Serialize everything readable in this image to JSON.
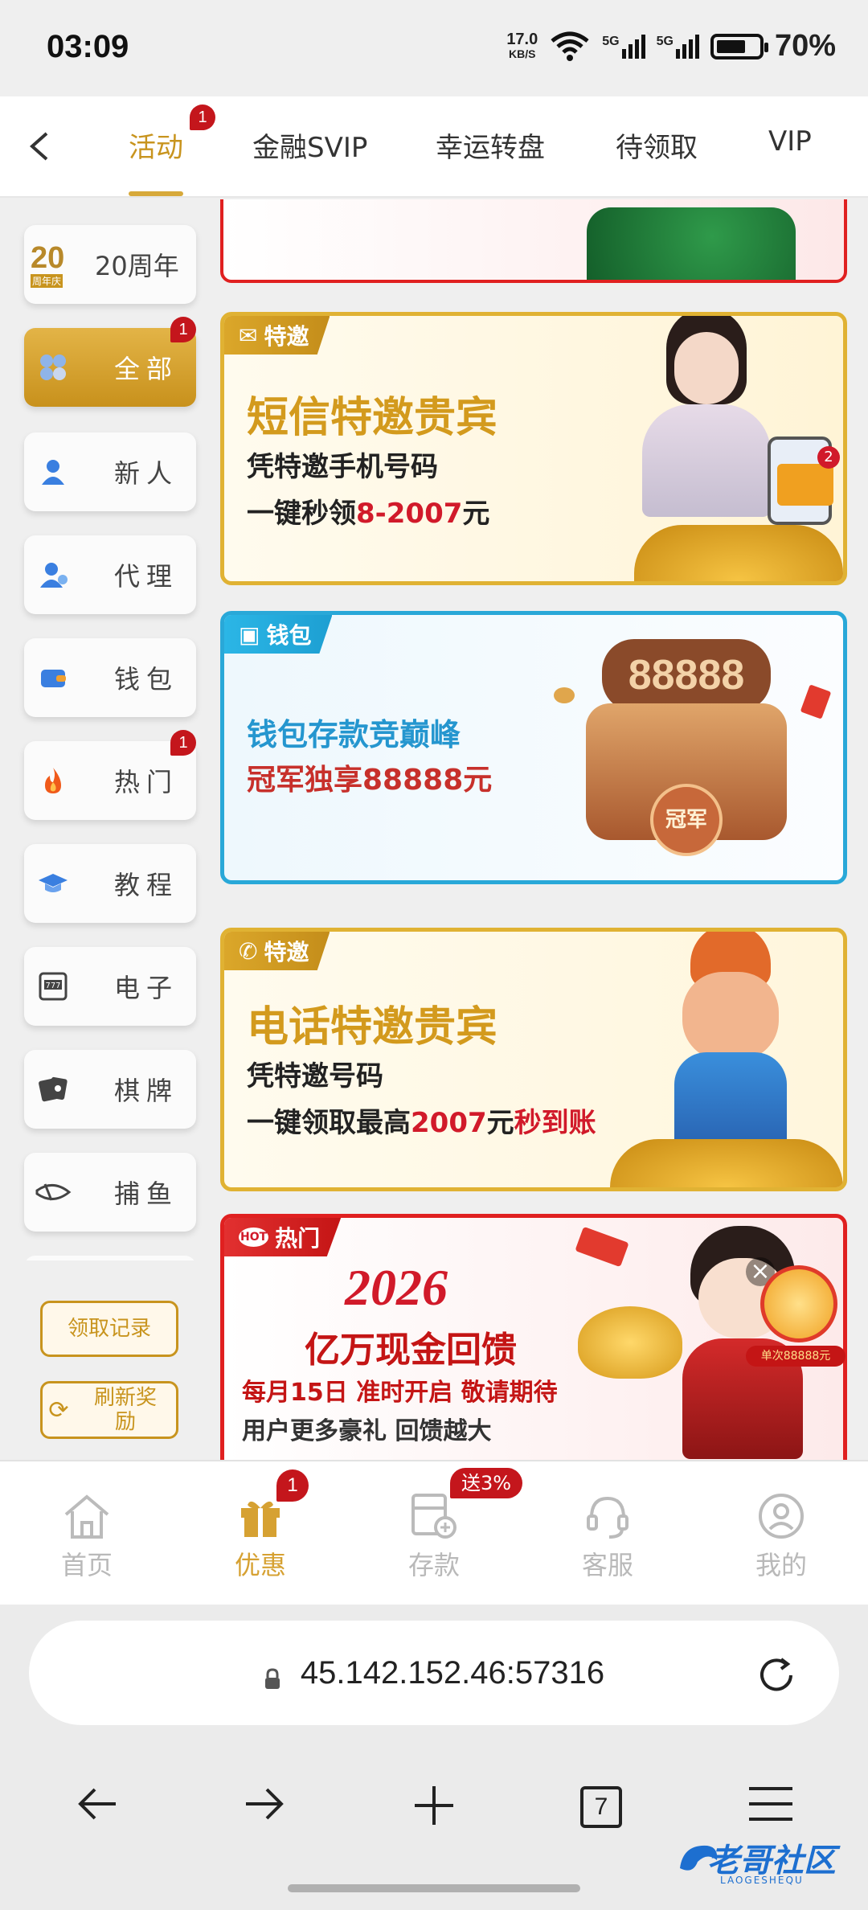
{
  "status": {
    "time": "03:09",
    "speed_value": "17.0",
    "speed_unit": "KB/S",
    "net1": "5G",
    "net2": "5G",
    "battery": "70%",
    "battery_level": 0.7
  },
  "topnav": {
    "tabs": [
      {
        "label": "活动",
        "badge": "1"
      },
      {
        "label": "金融SVIP"
      },
      {
        "label": "幸运转盘"
      },
      {
        "label": "待领取"
      },
      {
        "label": "VIP"
      }
    ]
  },
  "sidebar": {
    "anniversary": {
      "badge_text": "20",
      "badge_sub": "周年庆",
      "label": "20周年"
    },
    "items": [
      {
        "label": "全部",
        "badge": "1",
        "icon": "grid-icon"
      },
      {
        "label": "新人",
        "icon": "user-icon"
      },
      {
        "label": "代理",
        "icon": "agent-icon"
      },
      {
        "label": "钱包",
        "icon": "wallet-icon"
      },
      {
        "label": "热门",
        "badge": "1",
        "icon": "fire-icon"
      },
      {
        "label": "教程",
        "icon": "graduation-cap-icon"
      },
      {
        "label": "电子",
        "icon": "slot-777-icon"
      },
      {
        "label": "棋牌",
        "icon": "cards-icon"
      },
      {
        "label": "捕鱼",
        "icon": "fish-icon"
      }
    ],
    "claim_record": "领取记录",
    "refresh_line1": "刷新奖",
    "refresh_line2": "励"
  },
  "banners": {
    "sms": {
      "tag": "特邀",
      "title": "短信特邀贵宾",
      "line1": "凭特邀手机号码",
      "line2_pre": "一键秒领",
      "line2_red": "8-2007",
      "line2_post": "元",
      "phone_badge": "2"
    },
    "wallet": {
      "tag": "钱包",
      "line1": "钱包存款竞巅峰",
      "line2": "冠军独享88888元",
      "art_number": "88888",
      "art_label": "冠军"
    },
    "phone": {
      "tag": "特邀",
      "title": "电话特邀贵宾",
      "line1": "凭特邀号码",
      "line2_pre": "一键领取最高",
      "line2_red": "2007",
      "line2_mid": "元",
      "line2_red2": "秒到账"
    },
    "hot": {
      "tag": "热门",
      "hot_label": "HOT",
      "year": "2026",
      "title": "亿万现金回馈",
      "line1": "每月15日 准时开启 敬请期待",
      "line2": "用户更多豪礼 回馈越大",
      "float_label": "单次88888元"
    }
  },
  "bottomnav": {
    "items": [
      {
        "label": "首页"
      },
      {
        "label": "优惠",
        "badge": "1"
      },
      {
        "label": "存款",
        "badge": "送3%"
      },
      {
        "label": "客服"
      },
      {
        "label": "我的"
      }
    ]
  },
  "browser": {
    "url": "45.142.152.46:57316",
    "tab_count": "7"
  },
  "watermark": {
    "text": "老哥社区",
    "sub": "LAOGESHEQU"
  }
}
